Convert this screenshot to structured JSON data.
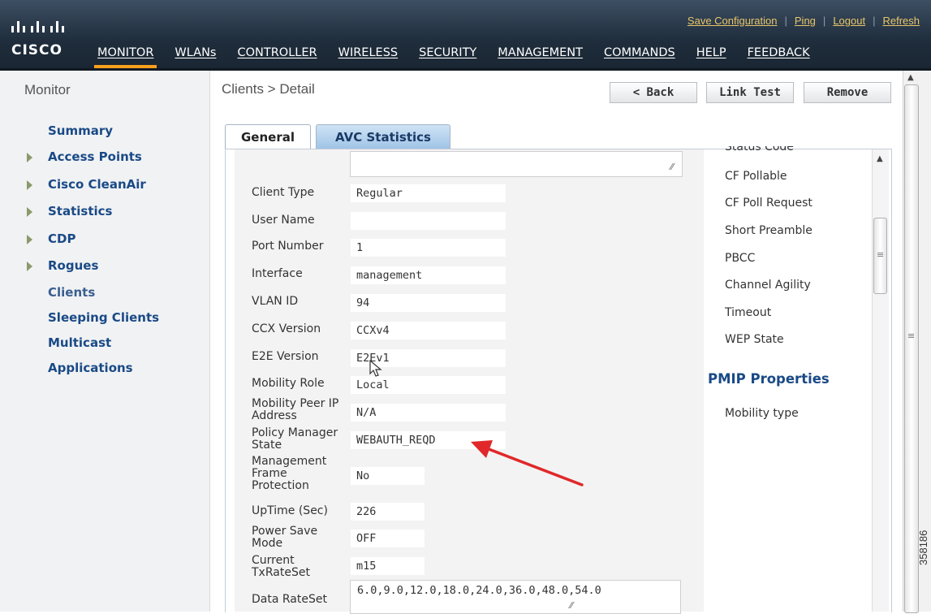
{
  "brand": {
    "logo_text": "CISCO"
  },
  "top_links": [
    "Save Configuration",
    "Ping",
    "Logout",
    "Refresh"
  ],
  "nav": [
    "MONITOR",
    "WLANs",
    "CONTROLLER",
    "WIRELESS",
    "SECURITY",
    "MANAGEMENT",
    "COMMANDS",
    "HELP",
    "FEEDBACK"
  ],
  "nav_active": "MONITOR",
  "sidebar": {
    "title": "Monitor",
    "items": [
      "Summary",
      "Access Points",
      "Cisco CleanAir",
      "Statistics",
      "CDP",
      "Rogues",
      "Clients",
      "Sleeping Clients",
      "Multicast",
      "Applications"
    ]
  },
  "page": {
    "breadcrumb": "Clients > Detail",
    "buttons": {
      "back": "< Back",
      "link_test": "Link Test",
      "remove": "Remove"
    },
    "tabs": [
      "General",
      "AVC Statistics"
    ],
    "active_tab": "General"
  },
  "client_props": [
    {
      "label": "Client Type",
      "value": "Regular"
    },
    {
      "label": "User Name",
      "value": ""
    },
    {
      "label": "Port Number",
      "value": "1"
    },
    {
      "label": "Interface",
      "value": "management"
    },
    {
      "label": "VLAN ID",
      "value": "94"
    },
    {
      "label": "CCX Version",
      "value": "CCXv4"
    },
    {
      "label": "E2E Version",
      "value": "E2Ev1"
    },
    {
      "label": "Mobility Role",
      "value": "Local"
    },
    {
      "label": "Mobility Peer IP Address",
      "value": "N/A"
    },
    {
      "label": "Policy Manager State",
      "value": "WEBAUTH_REQD"
    },
    {
      "label": "Management Frame Protection",
      "value": "No"
    },
    {
      "label": "UpTime (Sec)",
      "value": "226"
    },
    {
      "label": "Power Save Mode",
      "value": "OFF"
    },
    {
      "label": "Current TxRateSet",
      "value": "m15"
    },
    {
      "label": "Data RateSet",
      "value": "6.0,9.0,12.0,18.0,24.0,36.0,48.0,54.0"
    }
  ],
  "right_props": {
    "cut_off_label": "Status Code",
    "labels": [
      "CF Pollable",
      "CF Poll Request",
      "Short Preamble",
      "PBCC",
      "Channel Agility",
      "Timeout",
      "WEP State"
    ],
    "section_title": "PMIP Properties",
    "pmip_labels": [
      "Mobility type"
    ]
  },
  "watermark": "358186",
  "colors": {
    "nav_active": "#f7a01d",
    "link_blue": "#1a4a86",
    "top_link": "#e8c66a",
    "arrow": "#e0282a"
  }
}
